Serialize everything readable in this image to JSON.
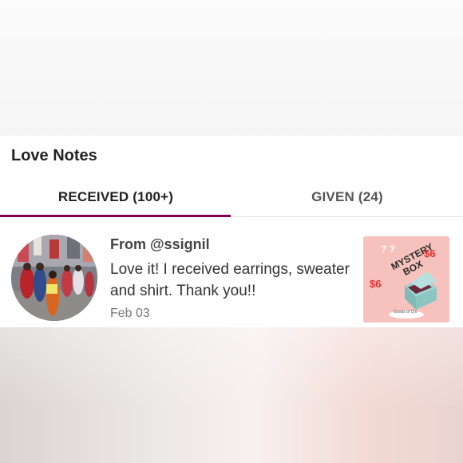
{
  "section": {
    "title": "Love Notes"
  },
  "tabs": [
    {
      "label": "RECEIVED (100+)",
      "active": true
    },
    {
      "label": "GIVEN (24)",
      "active": false
    }
  ],
  "note": {
    "from": "From @ssignil",
    "body": "Love it! I received earrings, sweater and shirt. Thank you!!",
    "date": "Feb 03"
  },
  "listing_image": {
    "heading": "MYSTERY BOX",
    "price_marks": [
      "$6",
      "$6"
    ],
    "caption": "Goods of Chi"
  },
  "colors": {
    "accent": "#7f0353",
    "thumb_background": "#f7c2bd"
  }
}
